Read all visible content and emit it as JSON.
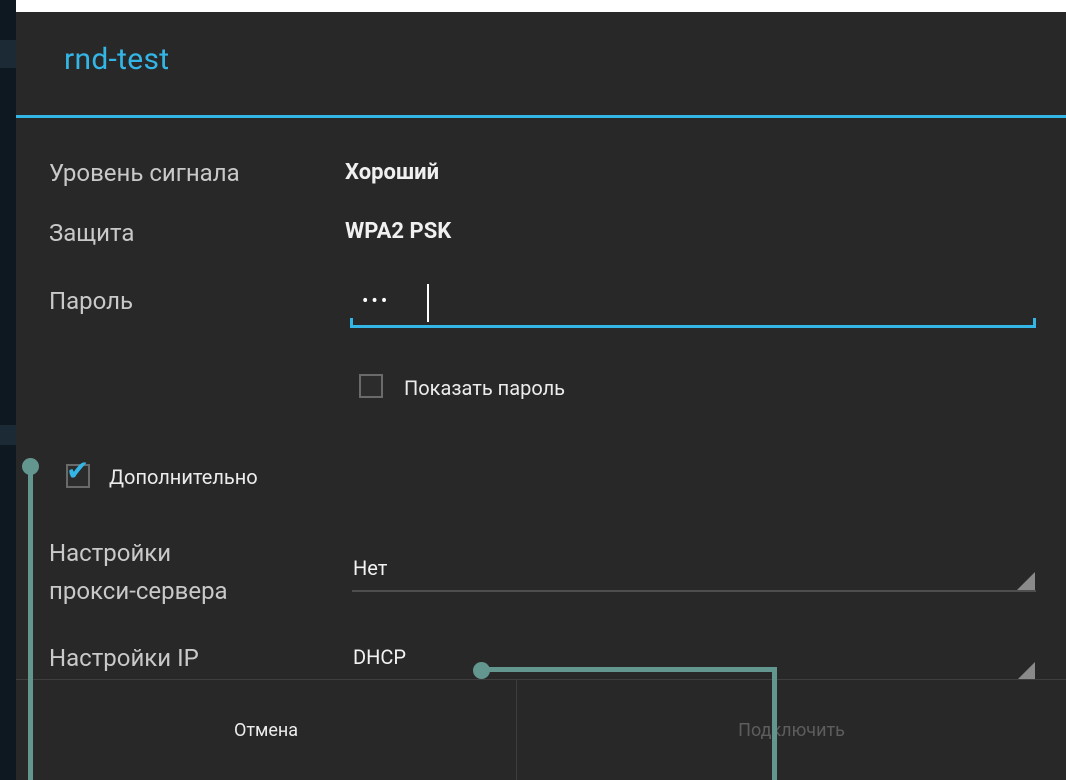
{
  "dialog": {
    "title": "rnd-test"
  },
  "details": {
    "signal_label": "Уровень сигнала",
    "signal_value": "Хороший",
    "security_label": "Защита",
    "security_value": "WPA2 PSK",
    "password_label": "Пароль",
    "password_value": "•••"
  },
  "show_password": {
    "label": "Показать пароль",
    "checked": false
  },
  "advanced": {
    "label": "Дополнительно",
    "checked": true
  },
  "proxy": {
    "label_line1": "Настройки",
    "label_line2": "прокси-сервера",
    "value": "Нет"
  },
  "ip": {
    "label": "Настройки IP",
    "value": "DHCP"
  },
  "buttons": {
    "cancel": "Отмена",
    "connect": "Подключить"
  },
  "colors": {
    "accent": "#33b5e5",
    "dialog_bg": "#282828",
    "annotation": "#62968f",
    "disabled_text": "#5d5d5d"
  }
}
